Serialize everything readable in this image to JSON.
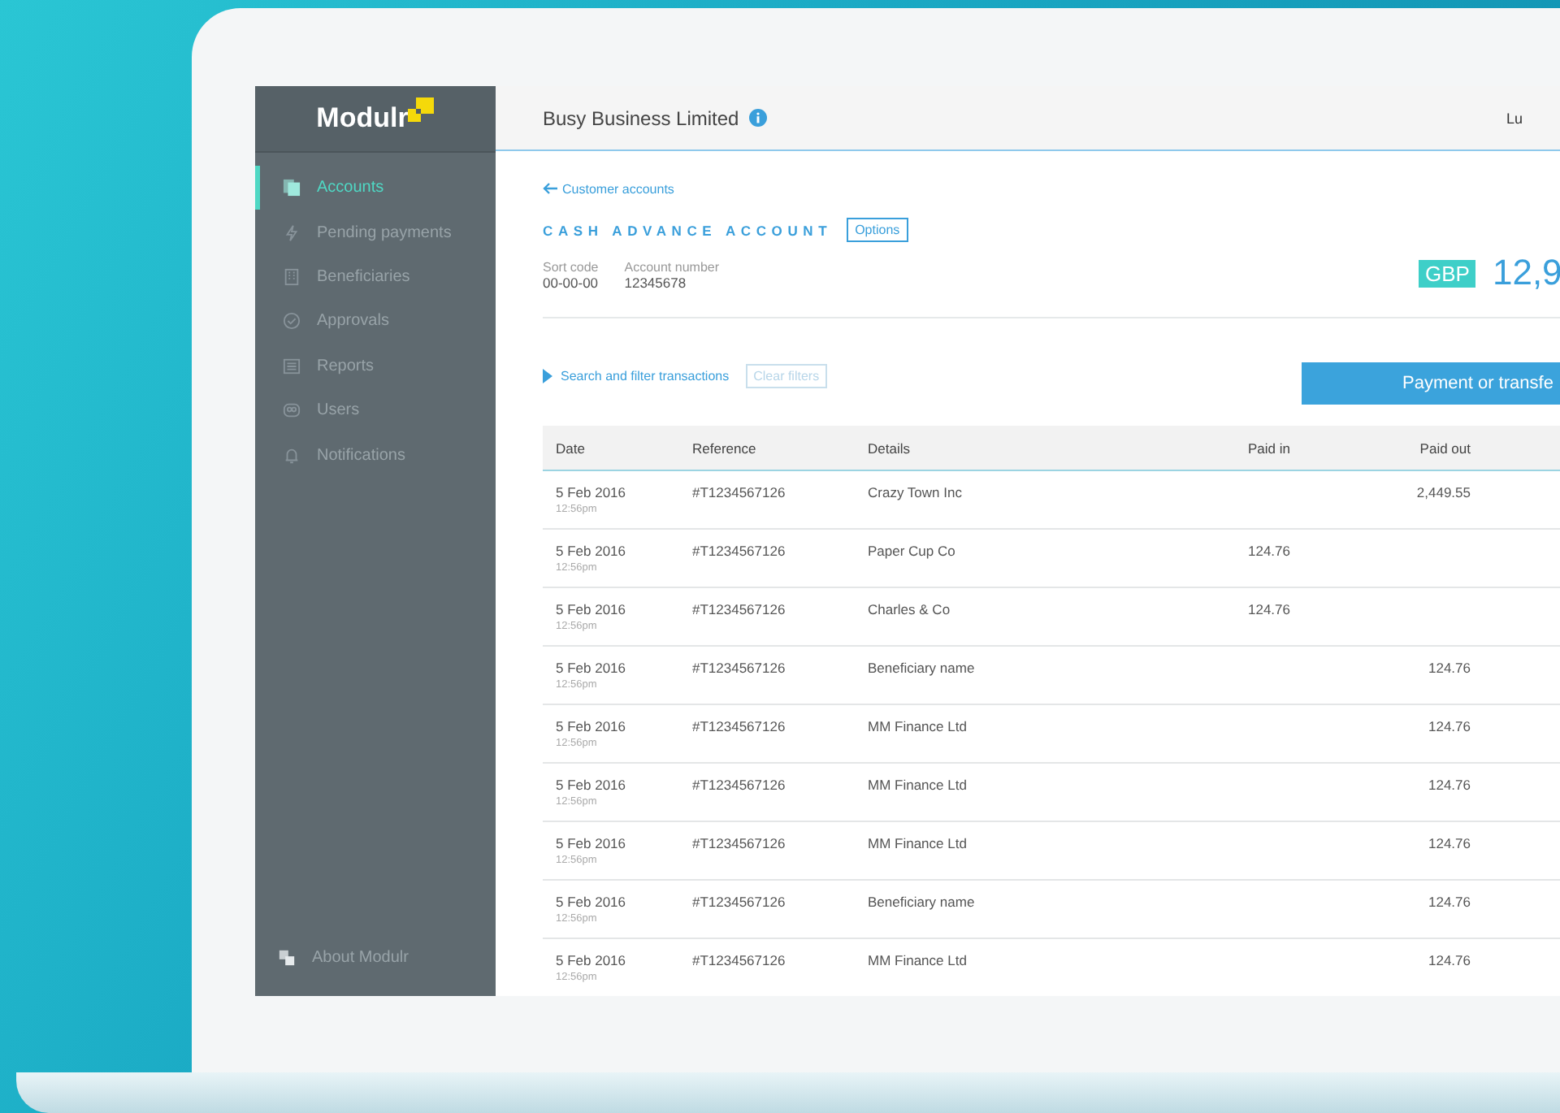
{
  "sidebar": {
    "logo": "Modulr",
    "items": [
      {
        "label": "Accounts",
        "selected": true
      },
      {
        "label": "Pending payments",
        "selected": false
      },
      {
        "label": "Beneficiaries",
        "selected": false
      },
      {
        "label": "Approvals",
        "selected": false
      },
      {
        "label": "Reports",
        "selected": false
      },
      {
        "label": "Users",
        "selected": false
      },
      {
        "label": "Notifications",
        "selected": false
      }
    ],
    "footer": "About Modulr"
  },
  "header": {
    "title": "Busy Business Limited",
    "user": "Lu"
  },
  "account": {
    "back_link": "Customer accounts",
    "name": "CASH ADVANCE ACCOUNT",
    "options": "Options",
    "sort_code_label": "Sort code",
    "sort_code": "00-00-00",
    "account_number_label": "Account number",
    "account_number": "12345678",
    "currency": "GBP",
    "balance": "12,9"
  },
  "filters": {
    "toggle": "Search and filter transactions",
    "clear": "Clear filters"
  },
  "payment_button": "Payment or transfe",
  "table": {
    "columns": [
      "Date",
      "Reference",
      "Details",
      "Paid in",
      "Paid out"
    ],
    "rows": [
      {
        "date": "5 Feb 2016",
        "time": "12:56pm",
        "reference": "#T1234567126",
        "details": "Crazy Town Inc",
        "paid_in": "",
        "paid_out": "2,449.55"
      },
      {
        "date": "5 Feb 2016",
        "time": "12:56pm",
        "reference": "#T1234567126",
        "details": "Paper Cup Co",
        "paid_in": "124.76",
        "paid_out": ""
      },
      {
        "date": "5 Feb 2016",
        "time": "12:56pm",
        "reference": "#T1234567126",
        "details": "Charles & Co",
        "paid_in": "124.76",
        "paid_out": ""
      },
      {
        "date": "5 Feb 2016",
        "time": "12:56pm",
        "reference": "#T1234567126",
        "details": "Beneficiary name",
        "paid_in": "",
        "paid_out": "124.76"
      },
      {
        "date": "5 Feb 2016",
        "time": "12:56pm",
        "reference": "#T1234567126",
        "details": "MM Finance Ltd",
        "paid_in": "",
        "paid_out": "124.76"
      },
      {
        "date": "5 Feb 2016",
        "time": "12:56pm",
        "reference": "#T1234567126",
        "details": "MM Finance Ltd",
        "paid_in": "",
        "paid_out": "124.76"
      },
      {
        "date": "5 Feb 2016",
        "time": "12:56pm",
        "reference": "#T1234567126",
        "details": "MM Finance Ltd",
        "paid_in": "",
        "paid_out": "124.76"
      },
      {
        "date": "5 Feb 2016",
        "time": "12:56pm",
        "reference": "#T1234567126",
        "details": "Beneficiary name",
        "paid_in": "",
        "paid_out": "124.76"
      },
      {
        "date": "5 Feb 2016",
        "time": "12:56pm",
        "reference": "#T1234567126",
        "details": "MM Finance Ltd",
        "paid_in": "",
        "paid_out": "124.76"
      }
    ]
  }
}
